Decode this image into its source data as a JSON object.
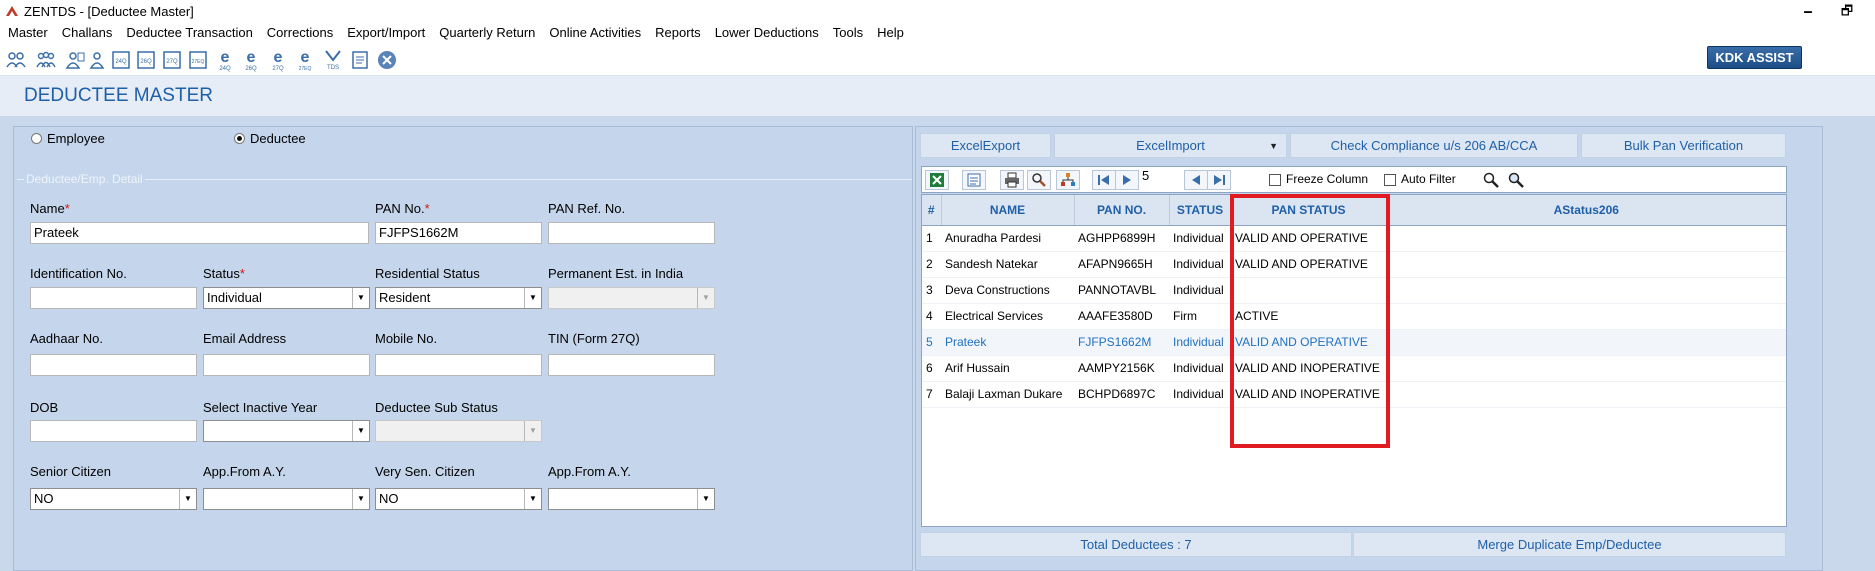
{
  "window": {
    "title": "ZENTDS - [Deductee Master]",
    "minimize": "🗕",
    "restore": "🗗"
  },
  "menu": [
    "Master",
    "Challans",
    "Deductee Transaction",
    "Corrections",
    "Export/Import",
    "Quarterly Return",
    "Online Activities",
    "Reports",
    "Lower Deductions",
    "Tools",
    "Help"
  ],
  "toolbar": {
    "kdk_assist": "KDK ASSIST",
    "icons": [
      "users-icon",
      "group-icon",
      "person-icon",
      "person-add-icon",
      "form-24q-icon",
      "form-26q-icon",
      "form-27q-icon",
      "form-27eq-icon",
      "e-24q-icon",
      "e-26q-icon",
      "e-27q-icon",
      "e-27eq-icon",
      "tds-icon",
      "document-icon",
      "close-icon"
    ]
  },
  "header": {
    "title": "DEDUCTEE MASTER"
  },
  "form": {
    "radio_employee": "Employee",
    "radio_deductee": "Deductee",
    "selected_type": "Deductee",
    "group_label": "Deductee/Emp. Detail",
    "name_label": "Name",
    "name_value": "Prateek",
    "pan_label": "PAN No.",
    "pan_value": "FJFPS1662M",
    "pan_ref_label": "PAN Ref. No.",
    "pan_ref_value": "",
    "identification_label": "Identification No.",
    "identification_value": "",
    "status_label": "Status",
    "status_value": "Individual",
    "residential_label": "Residential Status",
    "residential_value": "Resident",
    "perm_est_label": "Permanent Est. in India",
    "perm_est_value": "",
    "aadhaar_label": "Aadhaar No.",
    "aadhaar_value": "",
    "email_label": "Email Address",
    "email_value": "",
    "mobile_label": "Mobile No.",
    "mobile_value": "",
    "tin_label": "TIN (Form 27Q)",
    "tin_value": "",
    "dob_label": "DOB",
    "dob_value": "",
    "inactive_year_label": "Select Inactive Year",
    "inactive_year_value": "",
    "sub_status_label": "Deductee Sub Status",
    "sub_status_value": "",
    "senior_label": "Senior Citizen",
    "senior_value": "NO",
    "app_from_label_1": "App.From A.Y.",
    "app_from_value_1": "",
    "very_senior_label": "Very Sen. Citizen",
    "very_senior_value": "NO",
    "app_from_label_2": "App.From A.Y.",
    "app_from_value_2": ""
  },
  "actions": {
    "excel_export": "ExcelExport",
    "excel_import": "ExcelImport",
    "check_compliance": "Check Compliance u/s 206 AB/CCA",
    "bulk_pan": "Bulk Pan Verification"
  },
  "grid_toolbar": {
    "page_value": "5",
    "freeze_column": "Freeze Column",
    "auto_filter": "Auto Filter"
  },
  "table": {
    "headers": [
      "#",
      "NAME",
      "PAN NO.",
      "STATUS",
      "PAN STATUS",
      "AStatus206"
    ],
    "rows": [
      [
        "1",
        "Anuradha Pardesi",
        "AGHPP6899H",
        "Individual",
        "VALID AND OPERATIVE",
        ""
      ],
      [
        "2",
        "Sandesh Natekar",
        "AFAPN9665H",
        "Individual",
        "VALID AND OPERATIVE",
        ""
      ],
      [
        "3",
        "Deva Constructions",
        "PANNOTAVBL",
        "Individual",
        "",
        ""
      ],
      [
        "4",
        "Electrical Services",
        "AAAFE3580D",
        "Firm",
        "ACTIVE",
        ""
      ],
      [
        "5",
        "Prateek",
        "FJFPS1662M",
        "Individual",
        "VALID AND OPERATIVE",
        ""
      ],
      [
        "6",
        "Arif Hussain",
        "AAMPY2156K",
        "Individual",
        "VALID AND INOPERATIVE",
        ""
      ],
      [
        "7",
        "Balaji Laxman Dukare",
        "BCHPD6897C",
        "Individual",
        "VALID AND INOPERATIVE",
        ""
      ]
    ],
    "selected_row_index": 4
  },
  "footer": {
    "total_deductees": "Total Deductees : 7",
    "merge_duplicate": "Merge Duplicate Emp/Deductee"
  },
  "colors": {
    "accent_blue": "#1f5fa8",
    "panel_bg": "#c5d6ec",
    "highlight_red": "#e11b22"
  }
}
